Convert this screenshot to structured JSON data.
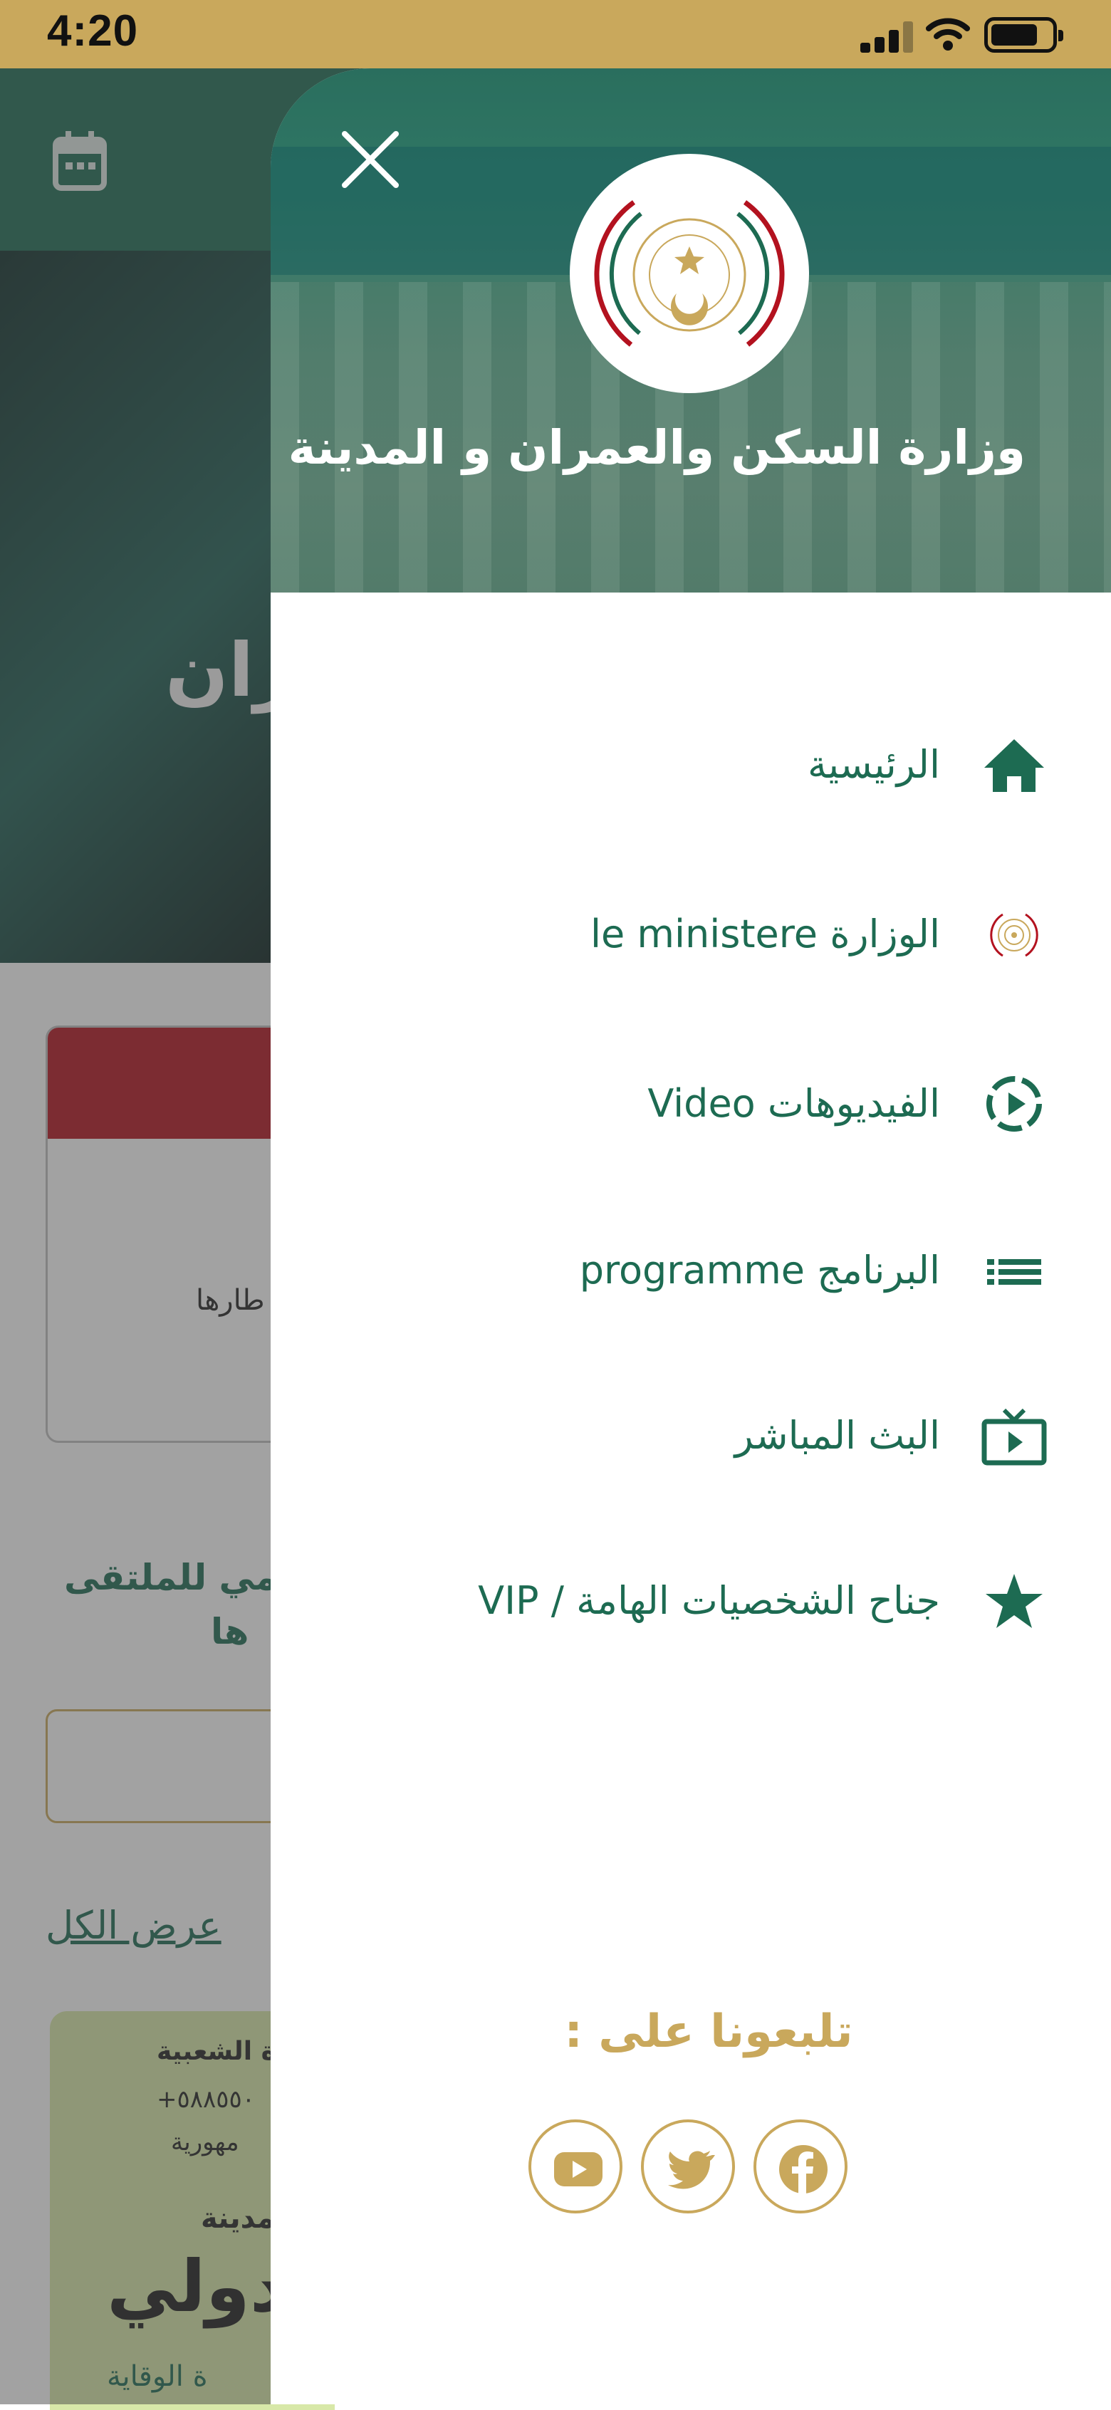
{
  "status_bar": {
    "time": "4:20"
  },
  "background": {
    "banner_text": "ران",
    "card_text": "طارها",
    "heading_line1": "مي للملتقى",
    "heading_line2": "ها",
    "view_all": "عرض الكل",
    "tile": {
      "line1": "ة الشعبية",
      "line2": "+٥٨٨٥٥٠",
      "line3": "مهورية",
      "line4": "مدينة",
      "line5": "دولي",
      "line6": "ة الوقاية"
    }
  },
  "drawer": {
    "title": "وزارة السكن والعمران و المدينة",
    "menu": [
      {
        "label": "الرئيسية",
        "icon": "home-icon"
      },
      {
        "label": "le ministere  الوزارة",
        "icon": "ministry-seal-icon"
      },
      {
        "label": "الفيديوهات Video",
        "icon": "play-circle-icon"
      },
      {
        "label": "البرنامج programme",
        "icon": "list-icon"
      },
      {
        "label": "البث المباشر",
        "icon": "live-tv-icon"
      },
      {
        "label": "جناح الشخصيات الهامة / VIP",
        "icon": "star-icon"
      }
    ],
    "follow_us": "تلبعونا على :",
    "social": [
      "youtube-icon",
      "twitter-icon",
      "facebook-icon"
    ]
  },
  "colors": {
    "primary_green": "#1d6b52",
    "gold": "#c9a85c",
    "status_bar": "#c9a85c"
  }
}
